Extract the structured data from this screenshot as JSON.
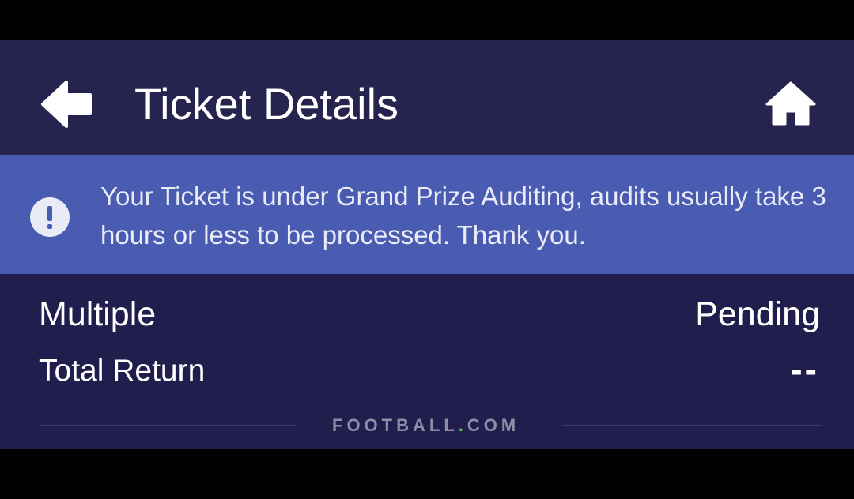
{
  "header": {
    "title": "Ticket Details",
    "back_icon": "arrow-left-icon",
    "home_icon": "home-icon"
  },
  "banner": {
    "icon": "exclamation-circle-icon",
    "message": "Your Ticket is under Grand Prize Auditing, audits usually take 3 hours or less to be processed. Thank you."
  },
  "ticket": {
    "bet_type": "Multiple",
    "status": "Pending",
    "total_return_label": "Total Return",
    "total_return_value": "--"
  },
  "footer": {
    "brand_left": "FOOTBALL",
    "brand_dot": ".",
    "brand_right": "COM",
    "brand_dot_color": "#5bbf3a"
  },
  "colors": {
    "header_bg": "#26244e",
    "banner_bg": "#4a5cb1",
    "content_bg": "#211e4d"
  }
}
